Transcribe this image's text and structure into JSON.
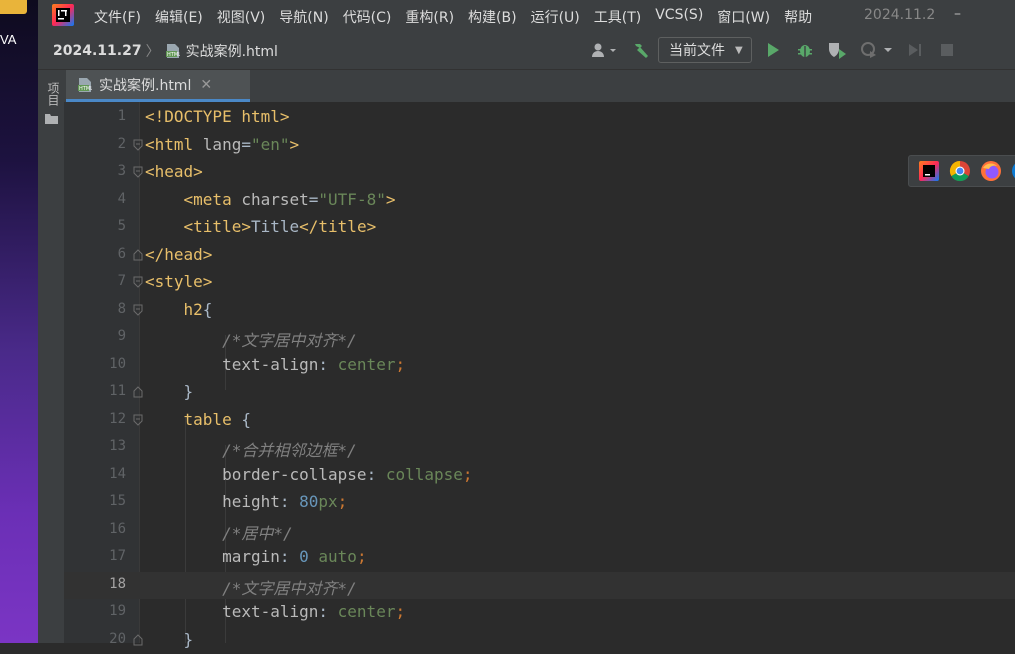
{
  "desktop": {
    "label": "VA"
  },
  "menubar": {
    "items": [
      "文件(F)",
      "编辑(E)",
      "视图(V)",
      "导航(N)",
      "代码(C)",
      "重构(R)",
      "构建(B)",
      "运行(U)",
      "工具(T)",
      "VCS(S)",
      "窗口(W)",
      "帮助"
    ],
    "project_title": "2024.11.2",
    "minimize": "–"
  },
  "navbar": {
    "project": "2024.11.27",
    "separator": "〉",
    "file": "实战案例.html",
    "run_config": "当前文件"
  },
  "sidestrip": {
    "label": "项目"
  },
  "tabs": [
    {
      "label": "实战案例.html",
      "close": "✕"
    }
  ],
  "editor": {
    "line_numbers": [
      "1",
      "2",
      "3",
      "4",
      "5",
      "6",
      "7",
      "8",
      "9",
      "10",
      "11",
      "12",
      "13",
      "14",
      "15",
      "16",
      "17",
      "18",
      "19",
      "20"
    ],
    "current_line": 18
  },
  "colors": {
    "tag": "#e8bf6a",
    "string": "#6a8759",
    "comment": "#808080",
    "number": "#6897bb",
    "keyword": "#cc7832",
    "text": "#a9b7c6",
    "tab_underline": "#4a88c7",
    "run_green": "#59a869"
  },
  "browser_icons": [
    "intellij-icon",
    "chrome-icon",
    "firefox-icon",
    "edge-icon"
  ]
}
